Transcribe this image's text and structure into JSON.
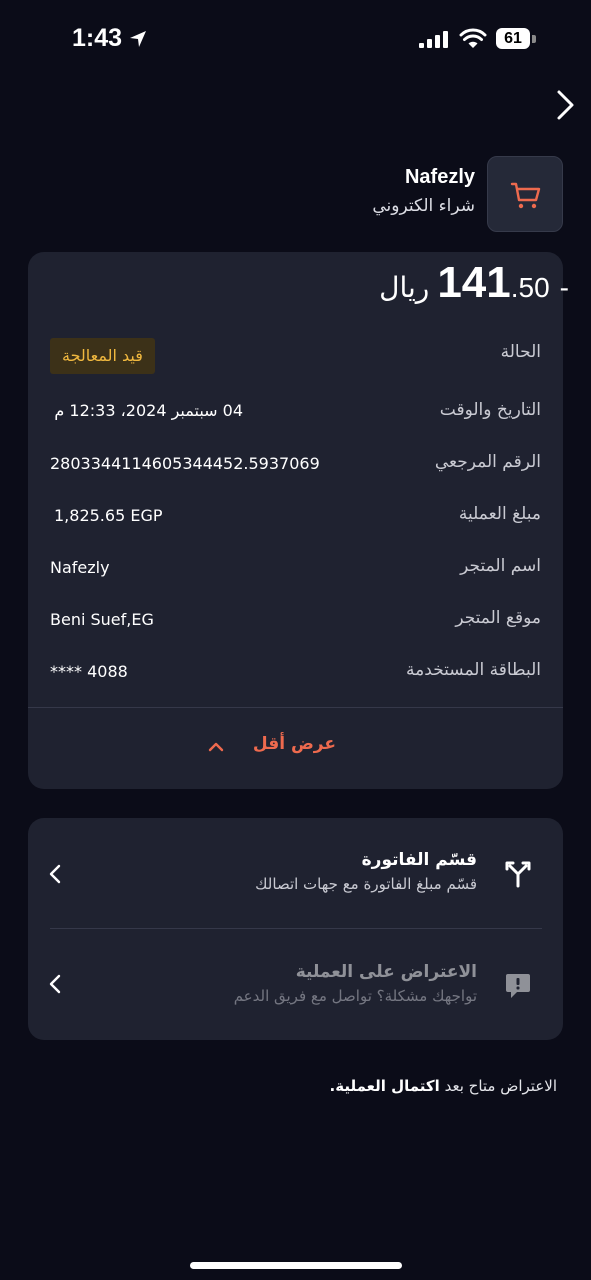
{
  "status_bar": {
    "time": "1:43",
    "battery": "61"
  },
  "merchant": {
    "name": "Nafezly",
    "type": "شراء الكتروني"
  },
  "amount": {
    "sign": "-",
    "fraction": ".50",
    "integer": "141",
    "currency": "ريال"
  },
  "details": {
    "status": {
      "label": "الحالة",
      "value": "قيد المعالجة"
    },
    "datetime": {
      "label": "التاريخ والوقت",
      "value": "04 سبتمبر 2024، 12:33 م"
    },
    "reference": {
      "label": "الرقم المرجعي",
      "value": "2803344114605344452.5937069"
    },
    "transaction_amount": {
      "label": "مبلغ العملية",
      "value": "1,825.65 EGP"
    },
    "merchant_name": {
      "label": "اسم المتجر",
      "value": "Nafezly"
    },
    "merchant_location": {
      "label": "موقع المتجر",
      "value": "Beni Suef,EG"
    },
    "card_used": {
      "label": "البطاقة المستخدمة",
      "value": "**** 4088"
    }
  },
  "show_less_label": "عرض أقل",
  "actions": {
    "split_bill": {
      "title": "قسّم الفاتورة",
      "subtitle": "قسّم مبلغ الفاتورة مع جهات اتصالك"
    },
    "dispute": {
      "title": "الاعتراض على العملية",
      "subtitle": "تواجهك مشكلة؟ تواصل مع فريق الدعم"
    }
  },
  "footnote": {
    "text": "الاعتراض متاح بعد",
    "bold": "اكتمال العملية."
  },
  "colors": {
    "background": "#0b0c18",
    "card": "#1f2230",
    "accent": "#ee6a4e",
    "pending": "#f0b83f"
  }
}
